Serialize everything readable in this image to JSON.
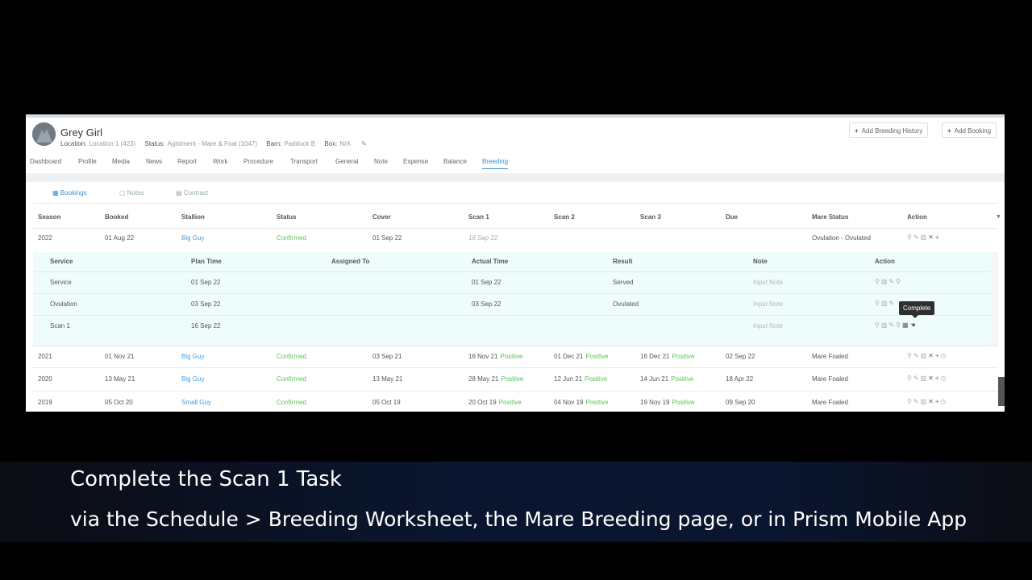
{
  "horse": {
    "name": "Grey Girl",
    "location_label": "Location:",
    "location": "Location 1 (423)",
    "status_label": "Status:",
    "status": "Agistment - Mare & Foal (1047)",
    "barn_label": "Barn:",
    "barn": "Paddock B",
    "box_label": "Box:",
    "box": "N/A"
  },
  "header_buttons": {
    "add_breeding_history": "Add Breeding History",
    "add_booking": "Add Booking"
  },
  "tabs": [
    "Dashboard",
    "Profile",
    "Media",
    "News",
    "Report",
    "Work",
    "Procedure",
    "Transport",
    "General",
    "Note",
    "Expense",
    "Balance",
    "Breeding"
  ],
  "active_tab": "Breeding",
  "subtabs": [
    "Bookings",
    "Notes",
    "Contract"
  ],
  "columns": [
    "Season",
    "Booked",
    "Stallion",
    "Status",
    "Cover",
    "Scan 1",
    "Scan 2",
    "Scan 3",
    "Due",
    "Mare Status",
    "Action"
  ],
  "row_2022": {
    "season": "2022",
    "booked": "01 Aug 22",
    "stallion": "Big Guy",
    "status": "Confirmed",
    "cover": "01 Sep 22",
    "scan1": "16 Sep 22",
    "mare_status": "Ovulation - Ovulated"
  },
  "sub_columns": [
    "Service",
    "Plan Time",
    "Assigned To",
    "Actual Time",
    "Result",
    "Note",
    "Action"
  ],
  "sub_rows": [
    {
      "service": "Service",
      "plan": "01 Sep 22",
      "actual": "01 Sep 22",
      "result": "Served",
      "note": "Input Note"
    },
    {
      "service": "Ovulation",
      "plan": "03 Sep 22",
      "actual": "03 Sep 22",
      "result": "Ovulated",
      "note": "Input Note"
    },
    {
      "service": "Scan 1",
      "plan": "16 Sep 22",
      "actual": "",
      "result": "",
      "note": "Input Note"
    }
  ],
  "tooltip": "Complete",
  "rows": [
    {
      "season": "2021",
      "booked": "01 Nov 21",
      "stallion": "Big Guy",
      "status": "Confirmed",
      "cover": "03 Sep 21",
      "scan1": "16 Nov 21",
      "scan2": "01 Dec 21",
      "scan3": "16 Dec 21",
      "result": "Positive",
      "due": "02 Sep 22",
      "mare_status": "Mare Foaled"
    },
    {
      "season": "2020",
      "booked": "13 May 21",
      "stallion": "Big Guy",
      "status": "Confirmed",
      "cover": "13 May 21",
      "scan1": "28 May 21",
      "scan2": "12 Jun 21",
      "scan3": "14 Jun 21",
      "result": "Positive",
      "due": "18 Apr 22",
      "mare_status": "Mare Foaled"
    },
    {
      "season": "2019",
      "booked": "05 Oct 20",
      "stallion": "Small Guy",
      "status": "Confirmed",
      "cover": "05 Oct 19",
      "scan1": "20 Oct 19",
      "scan2": "04 Nov 19",
      "scan3": "19 Nov 19",
      "result": "Positive",
      "due": "09 Sep 20",
      "mare_status": "Mare Foaled"
    }
  ],
  "caption": {
    "line1": "Complete the Scan 1 Task",
    "line2": "via the Schedule > Breeding Worksheet, the Mare Breeding page, or in Prism Mobile App"
  },
  "colors": {
    "accent": "#3a8fd6",
    "positive": "#5cc15c",
    "subpanel": "#eefcfb",
    "caption_bg": "#0a1630"
  }
}
